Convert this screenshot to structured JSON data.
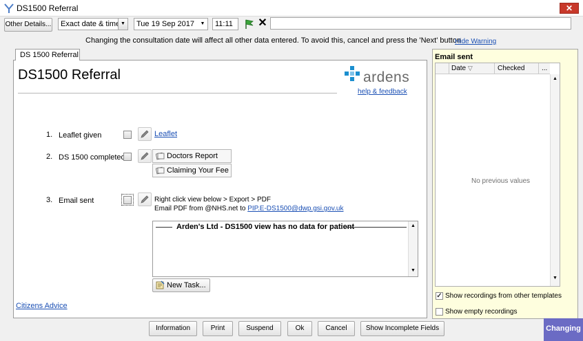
{
  "window": {
    "title": "DS1500 Referral",
    "close_label": "✕"
  },
  "toolbar": {
    "other_details_label": "Other Details...",
    "date_mode": "Exact date & time",
    "date_value": "Tue 19 Sep 2017",
    "time_value": "11:11",
    "free_text_value": ""
  },
  "warning": {
    "text": "Changing the consultation date will affect all other data entered. To avoid this, cancel and press the 'Next' button",
    "hide_label": "Hide Warning"
  },
  "form": {
    "tab_label": "DS 1500 Referral",
    "title": "DS1500 Referral",
    "logo_text": "ardens",
    "help_link": "help & feedback",
    "items": [
      {
        "number": "1.",
        "label": "Leaflet given",
        "link": "Leaflet"
      },
      {
        "number": "2.",
        "label": "DS 1500 completed",
        "buttons": [
          "Doctors Report",
          "Claiming Your Fee"
        ]
      },
      {
        "number": "3.",
        "label": "Email sent",
        "instruction": "Right click view below > Export > PDF",
        "email_prefix": "Email PDF from @NHS.net to ",
        "email_link": "PIP.E-DS1500@dwp.gsi.gov.uk"
      }
    ],
    "view_heading": "Arden's Ltd - DS1500 view has no data for patient",
    "new_task_label": "New Task...",
    "citizens_advice_link": "Citizens Advice"
  },
  "right_panel": {
    "title": "Email sent",
    "columns": [
      "Date",
      "Checked",
      "..."
    ],
    "empty_text": "No previous values",
    "show_other_templates": {
      "label": "Show recordings from other templates",
      "checked": true
    },
    "show_empty": {
      "label": "Show empty recordings",
      "checked": false
    }
  },
  "bottom_bar": {
    "information": "Information",
    "print": "Print",
    "suspend": "Suspend",
    "ok": "Ok",
    "cancel": "Cancel",
    "show_incomplete": "Show Incomplete Fields",
    "status": "Changing"
  },
  "colors": {
    "accent": "#6b6bc4",
    "link": "#1a4fb4",
    "panel_bg": "#fefede",
    "logo_blue": "#1b8fcf"
  }
}
